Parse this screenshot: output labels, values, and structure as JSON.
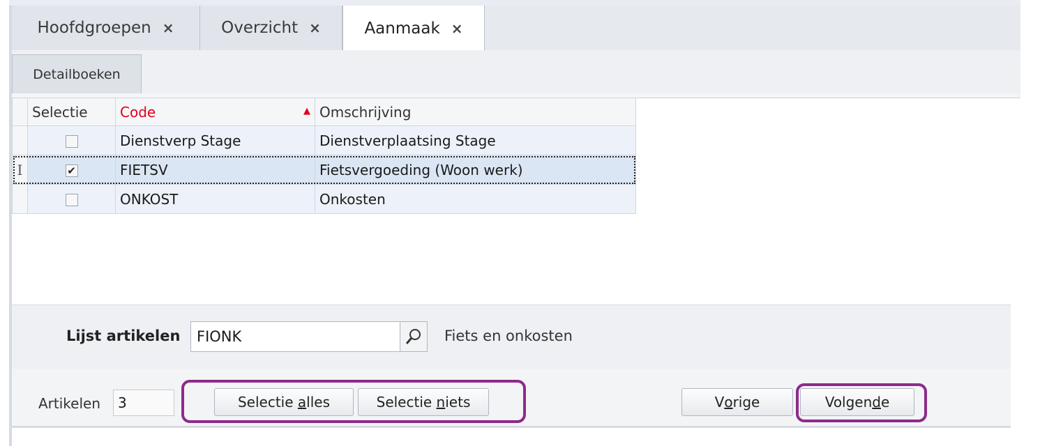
{
  "tabs": [
    {
      "label": "Hoofdgroepen",
      "close": "×"
    },
    {
      "label": "Overzicht",
      "close": "×"
    },
    {
      "label": "Aanmaak",
      "close": "×"
    }
  ],
  "subtabs": [
    {
      "label": "Detailboeken"
    }
  ],
  "grid": {
    "headers": {
      "selectie": "Selectie",
      "code": "Code",
      "omschrijving": "Omschrijving"
    },
    "rows": [
      {
        "selected": false,
        "code": "Dienstverp Stage",
        "omschrijving": "Dienstverplaatsing Stage"
      },
      {
        "selected": true,
        "code": "FIETSV",
        "omschrijving": "Fietsvergoeding (Woon werk)",
        "current": true
      },
      {
        "selected": false,
        "code": "ONKOST",
        "omschrijving": "Onkosten"
      }
    ],
    "code_header_color": "#e0001b"
  },
  "lijst": {
    "label": "Lijst artikelen",
    "value": "FIONK",
    "description": "Fiets en onkosten",
    "search_icon": "search-icon"
  },
  "footer": {
    "artikelen_label": "Artikelen",
    "artikelen_value": "3",
    "btn_selectie_alles": {
      "pre": "Selectie ",
      "u": "a",
      "post": "lles"
    },
    "btn_selectie_niets": {
      "pre": "Selectie ",
      "u": "n",
      "post": "iets"
    },
    "btn_vorige": {
      "pre": "V",
      "u": "o",
      "post": "rige"
    },
    "btn_volgende": {
      "pre": "Volgen",
      "u": "d",
      "post": "e"
    }
  },
  "highlight_color": "#8e2a8a"
}
